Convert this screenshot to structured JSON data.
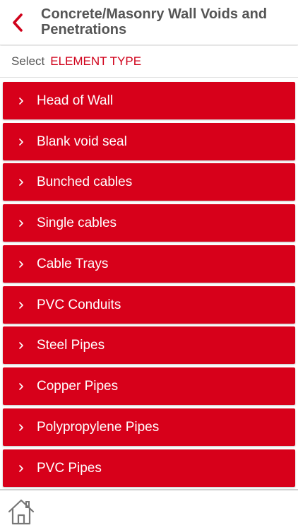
{
  "header": {
    "title": "Concrete/Masonry Wall Voids and Penetrations",
    "back_icon": "chevron-left-icon"
  },
  "selector": {
    "prefix": "Select",
    "value": "ELEMENT TYPE"
  },
  "items": [
    {
      "label": "Head of Wall"
    },
    {
      "label": "Blank void seal"
    },
    {
      "label": "Bunched cables"
    },
    {
      "label": "Single cables"
    },
    {
      "label": "Cable Trays"
    },
    {
      "label": "PVC Conduits"
    },
    {
      "label": "Steel Pipes"
    },
    {
      "label": "Copper Pipes"
    },
    {
      "label": "Polypropylene Pipes"
    },
    {
      "label": "PVC Pipes"
    }
  ],
  "footer": {
    "home_icon": "home-icon"
  },
  "colors": {
    "accent": "#d7001a",
    "text": "#555555",
    "item_text": "#ffffff"
  }
}
